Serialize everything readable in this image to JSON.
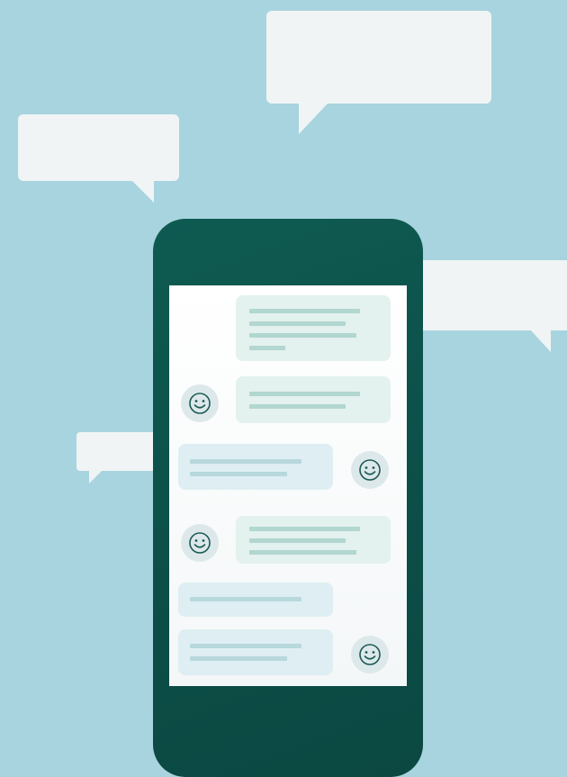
{
  "illustration": {
    "accent_color": "#0e5b52",
    "background_color": "#a8d4df",
    "bubble_color": "#f0f4f5",
    "avatar_icon": "smiley-face-icon"
  },
  "conversation": [
    {
      "side": "right",
      "lines": 4,
      "avatar": false
    },
    {
      "side": "right",
      "lines": 2,
      "avatar": true
    },
    {
      "side": "left",
      "lines": 2,
      "avatar": true
    },
    {
      "side": "right",
      "lines": 3,
      "avatar": true
    },
    {
      "side": "left",
      "lines": 1,
      "avatar": false
    },
    {
      "side": "left",
      "lines": 2,
      "avatar": true
    }
  ]
}
